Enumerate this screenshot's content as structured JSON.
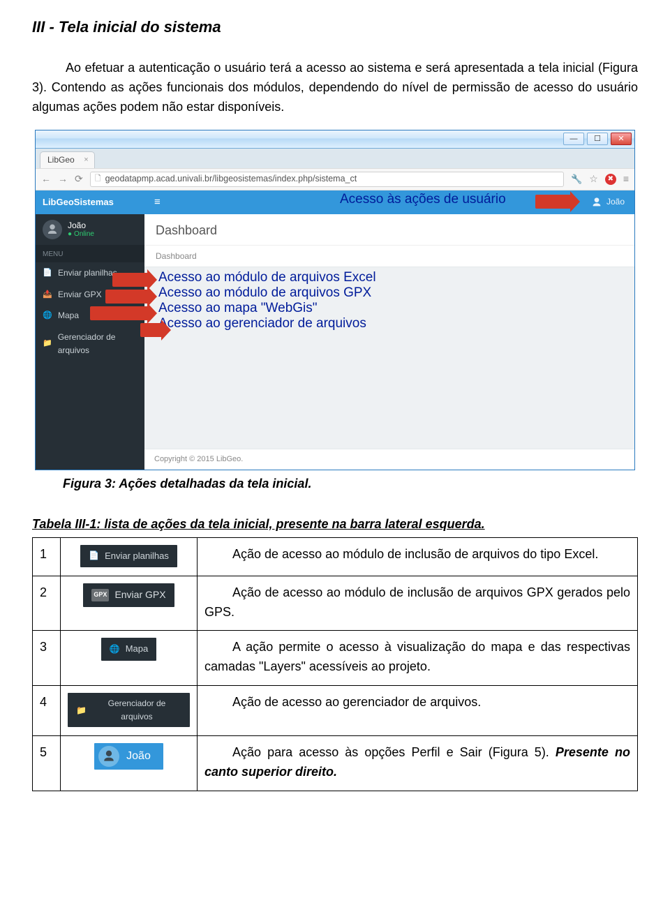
{
  "heading": "III - Tela inicial do sistema",
  "para1": "Ao efetuar a autenticação o usuário terá a acesso ao sistema e será apresentada a tela inicial (Figura 3). Contendo as ações funcionais dos módulos, dependendo do nível de permissão de acesso do usuário algumas ações podem não estar disponíveis.",
  "screenshot": {
    "tab_title": "LibGeo",
    "url": "geodatapmp.acad.univali.br/libgeosistemas/index.php/sistema_ct",
    "brand": "LibGeoSistemas",
    "username": "João",
    "online": "Online",
    "menu_header": "MENU",
    "nav": [
      {
        "icon": "📄",
        "label": "Enviar planilhas"
      },
      {
        "icon": "📤",
        "label": "Enviar GPX"
      },
      {
        "icon": "🌐",
        "label": "Mapa"
      },
      {
        "icon": "📁",
        "label": "Gerenciador de arquivos"
      }
    ],
    "dashboard_title": "Dashboard",
    "breadcrumb": "Dashboard",
    "topright_user": "João",
    "footer": "Copyright © 2015 LibGeo.",
    "callout_top": "Acesso às ações de usuário",
    "callout_lines": [
      "Acesso ao módulo de arquivos Excel",
      "Acesso ao módulo de arquivos GPX",
      "Acesso ao mapa \"WebGis\"",
      "Acesso ao gerenciador de arquivos"
    ]
  },
  "figcaption": "Figura 3: Ações detalhadas da tela inicial.",
  "table_caption": "Tabela III-1: lista de ações da tela inicial, presente na barra lateral esquerda.",
  "rows": [
    {
      "n": "1",
      "chip": "Enviar planilhas",
      "desc_pre": "",
      "desc": "Ação de acesso ao módulo de inclusão de arquivos do tipo Excel."
    },
    {
      "n": "2",
      "chip": "Enviar GPX",
      "desc_pre": "",
      "desc": "Ação de acesso ao módulo de inclusão de arquivos GPX gerados pelo GPS."
    },
    {
      "n": "3",
      "chip": "Mapa",
      "desc_pre": "",
      "desc": "A ação permite o acesso à visualização do mapa e das respectivas camadas \"Layers\" acessíveis ao projeto."
    },
    {
      "n": "4",
      "chip": "Gerenciador de arquivos",
      "desc_pre": "",
      "desc": "Ação de acesso ao gerenciador de arquivos."
    },
    {
      "n": "5",
      "chip": "João",
      "desc_pre": "",
      "desc": "Ação para acesso às opções Perfil e Sair (Figura 5). ",
      "desc_bold": "Presente no canto superior direito."
    }
  ]
}
